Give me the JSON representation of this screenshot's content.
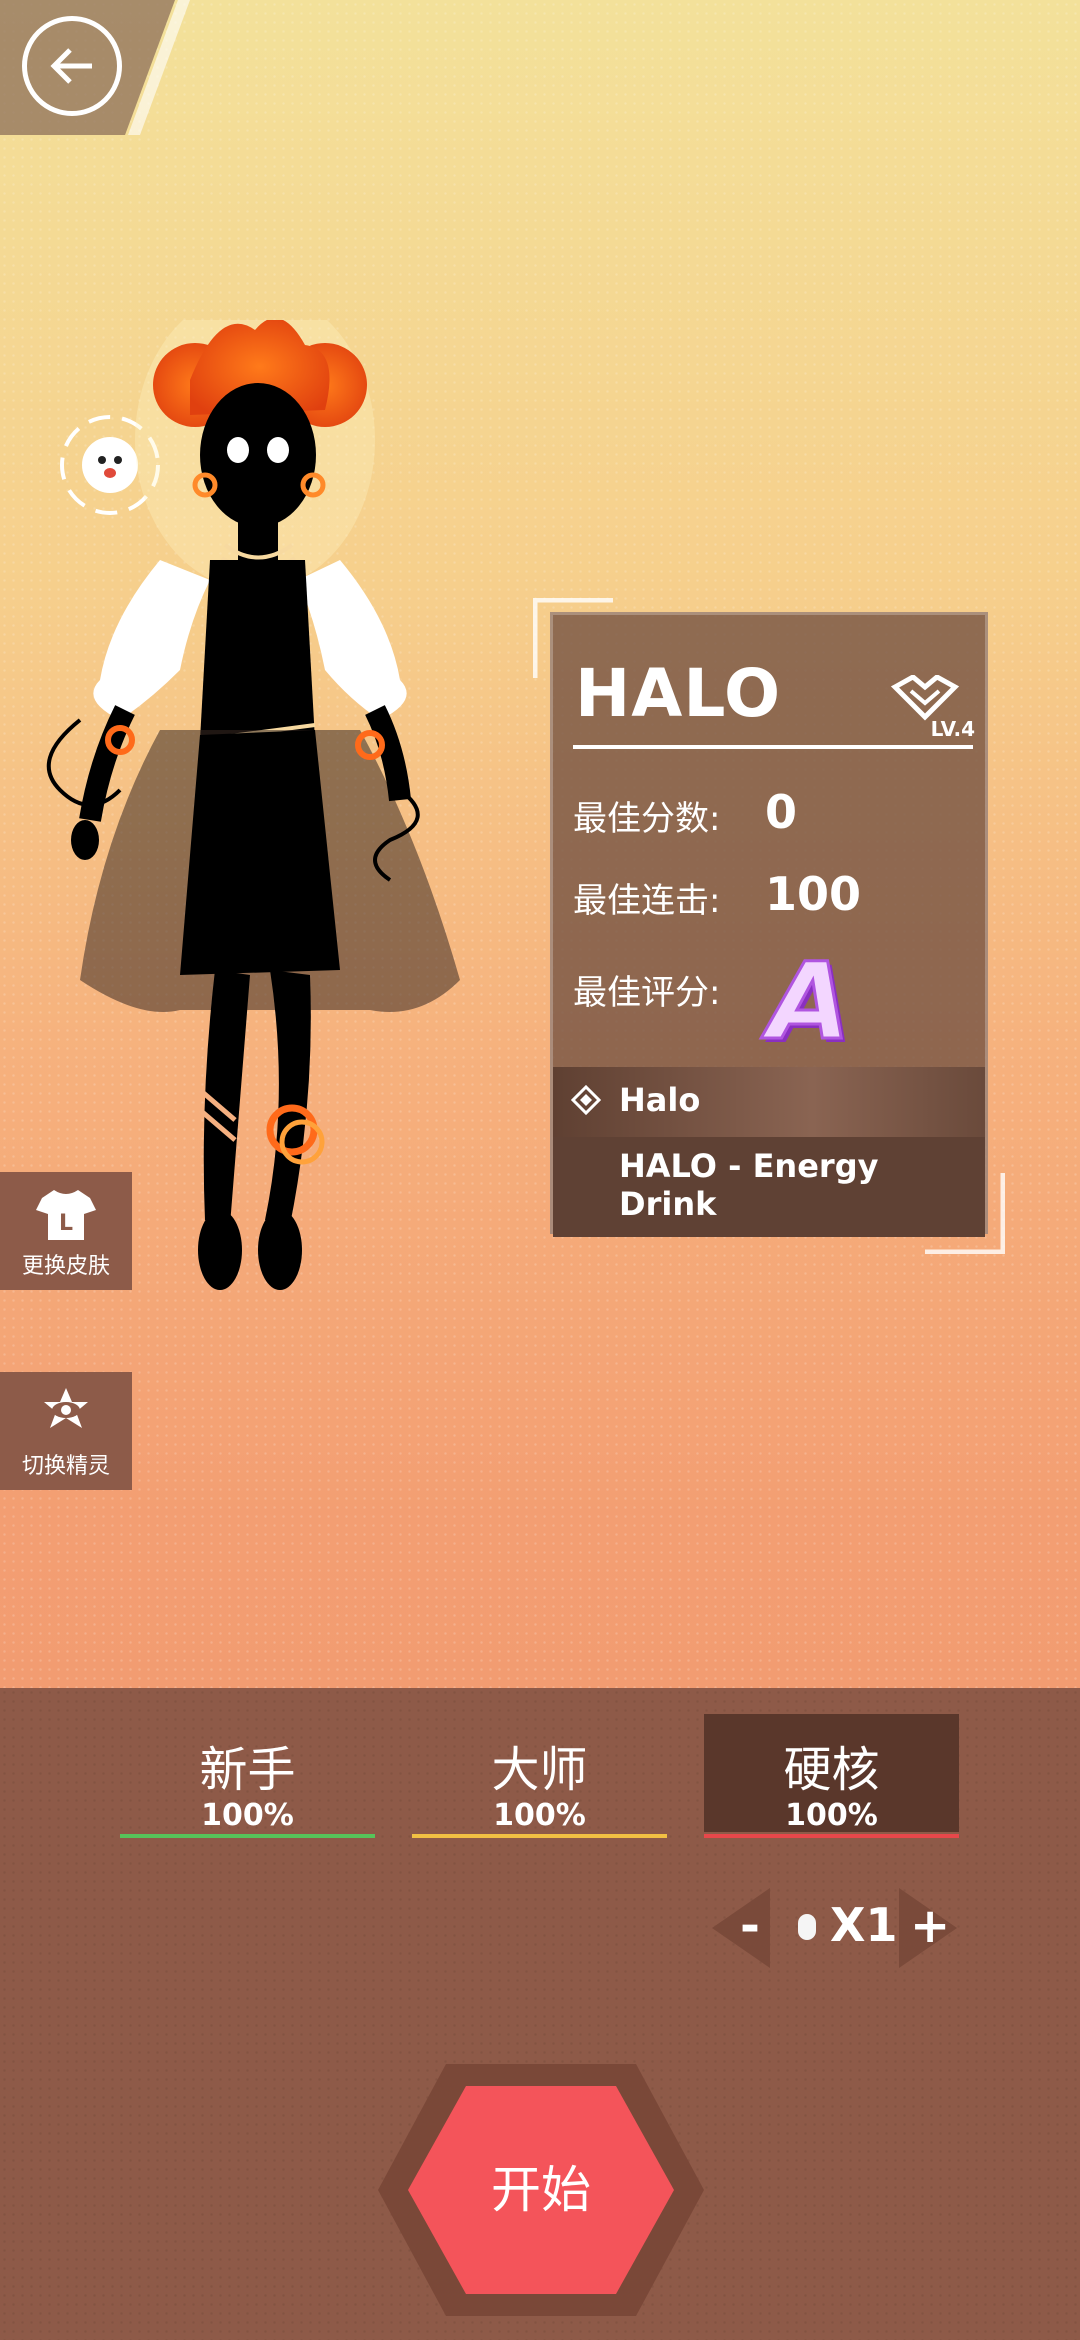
{
  "nav": {
    "back_icon": "back-arrow-icon"
  },
  "skin_button": {
    "label": "更换皮肤",
    "icon": "shirt-icon"
  },
  "sprite_button": {
    "label": "切换精灵",
    "icon": "eye-icon"
  },
  "song_card": {
    "title": "HALO",
    "level": "LV.4",
    "best_score_label": "最佳分数:",
    "best_score": "0",
    "best_combo_label": "最佳连击:",
    "best_combo": "100",
    "best_rank_label": "最佳评分:",
    "best_rank": "A",
    "songs": [
      {
        "name": "Halo"
      },
      {
        "name": "HALO - Energy Drink"
      }
    ]
  },
  "difficulties": [
    {
      "name": "新手",
      "percent": "100%",
      "color": "#57c45a"
    },
    {
      "name": "大师",
      "percent": "100%",
      "color": "#f2c043"
    },
    {
      "name": "硬核",
      "percent": "100%",
      "color": "#e8474a",
      "selected": true
    }
  ],
  "speed": {
    "minus": "-",
    "value": "X1",
    "plus": "+"
  },
  "start_button": {
    "label": "开始",
    "color": "#f4545a"
  }
}
